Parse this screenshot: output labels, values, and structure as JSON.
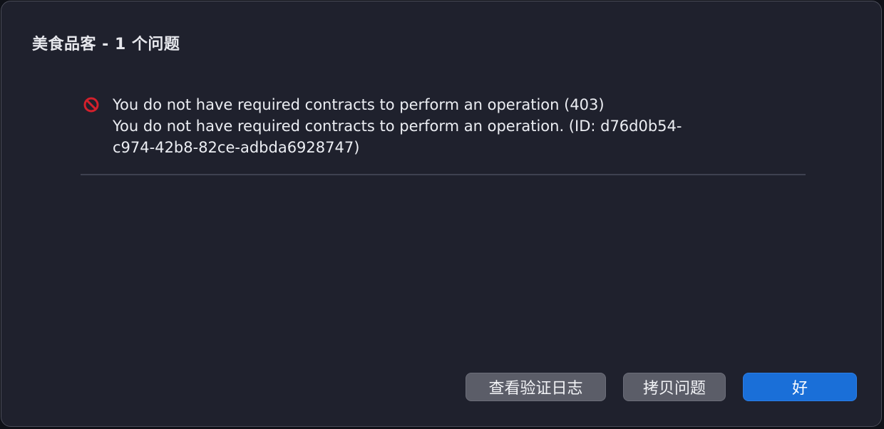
{
  "dialog": {
    "title": "美食品客 - 1 个问题"
  },
  "issue": {
    "icon": "error-no-entry-icon",
    "line1": "You do not have required contracts to perform an operation (403)",
    "line2": "You do not have required contracts to perform an operation. (ID: d76d0b54-",
    "line3": "c974-42b8-82ce-adbda6928747)"
  },
  "buttons": {
    "view_log": "查看验证日志",
    "copy_issue": "拷贝问题",
    "ok": "好"
  },
  "colors": {
    "background": "#1f212d",
    "error_icon": "#d3202c",
    "primary_button": "#1a6fd8",
    "secondary_button": "#5b5d68"
  }
}
